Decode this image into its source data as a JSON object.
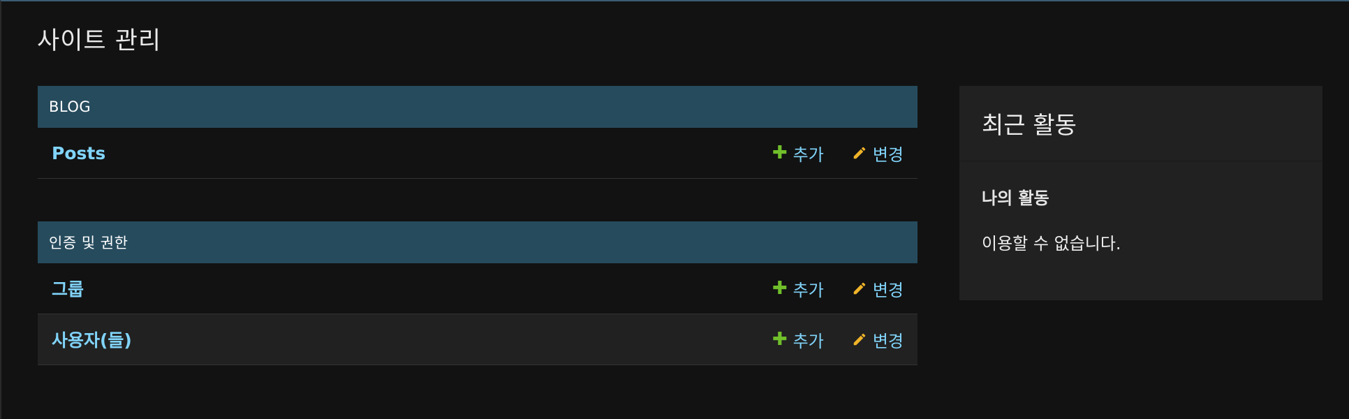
{
  "page": {
    "title": "사이트 관리"
  },
  "modules": [
    {
      "header": "BLOG",
      "rows": [
        {
          "model": "Posts",
          "add_label": "추가",
          "change_label": "변경"
        }
      ]
    },
    {
      "header": "인증 및 권한",
      "rows": [
        {
          "model": "그룹",
          "add_label": "추가",
          "change_label": "변경"
        },
        {
          "model": "사용자(들)",
          "add_label": "추가",
          "change_label": "변경"
        }
      ]
    }
  ],
  "recent_actions": {
    "title": "최근 활동",
    "subtitle": "나의 활동",
    "empty_text": "이용할 수 없습니다."
  },
  "colors": {
    "background": "#121212",
    "module_header": "#264b5d",
    "link": "#81d4fa",
    "add_icon": "#70bf2b",
    "change_icon": "#f0b429",
    "panel": "#212121"
  },
  "icons": {
    "add": "plus-icon",
    "change": "pencil-icon"
  }
}
